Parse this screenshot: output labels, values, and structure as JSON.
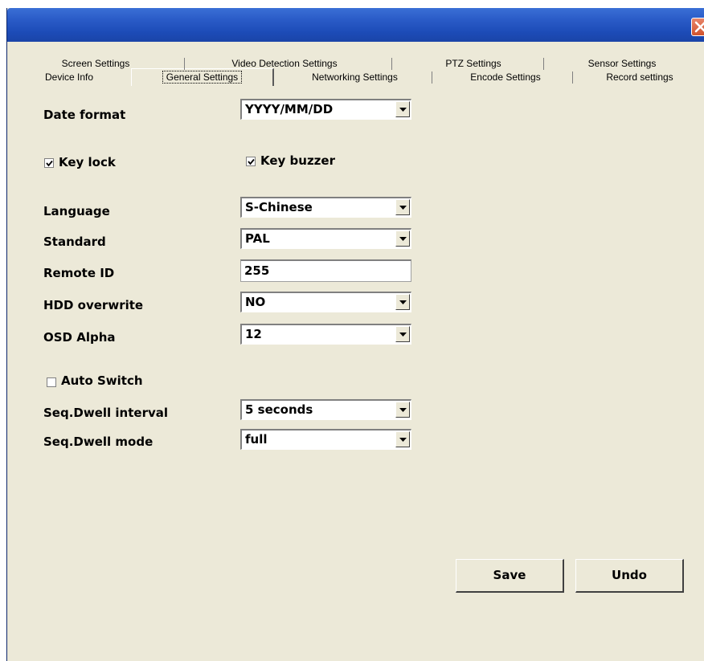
{
  "window": {
    "close_icon": "close-x-icon",
    "accent": "#1d4cb8"
  },
  "tabs": {
    "row1": [
      "Screen Settings",
      "Video Detection Settings",
      "PTZ Settings",
      "Sensor Settings"
    ],
    "row2": [
      "Device Info",
      "General Settings",
      "Networking Settings",
      "Encode Settings",
      "Record settings"
    ],
    "active": "General Settings"
  },
  "form": {
    "date_format": {
      "label": "Date format",
      "value": "YYYY/MM/DD"
    },
    "key_lock": {
      "label": "Key lock",
      "checked": true
    },
    "key_buzzer": {
      "label": "Key buzzer",
      "checked": true
    },
    "language": {
      "label": "Language",
      "value": "S-Chinese"
    },
    "standard": {
      "label": "Standard",
      "value": "PAL"
    },
    "remote_id": {
      "label": "Remote ID",
      "value": "255"
    },
    "hdd_overwrite": {
      "label": "HDD overwrite",
      "value": "NO"
    },
    "osd_alpha": {
      "label": "OSD Alpha",
      "value": "12"
    },
    "auto_switch": {
      "label": "Auto Switch",
      "checked": false
    },
    "seq_dwell_interval": {
      "label": "Seq.Dwell interval",
      "value": "5 seconds"
    },
    "seq_dwell_mode": {
      "label": "Seq.Dwell mode",
      "value": "full"
    }
  },
  "buttons": {
    "save": "Save",
    "undo": "Undo"
  }
}
